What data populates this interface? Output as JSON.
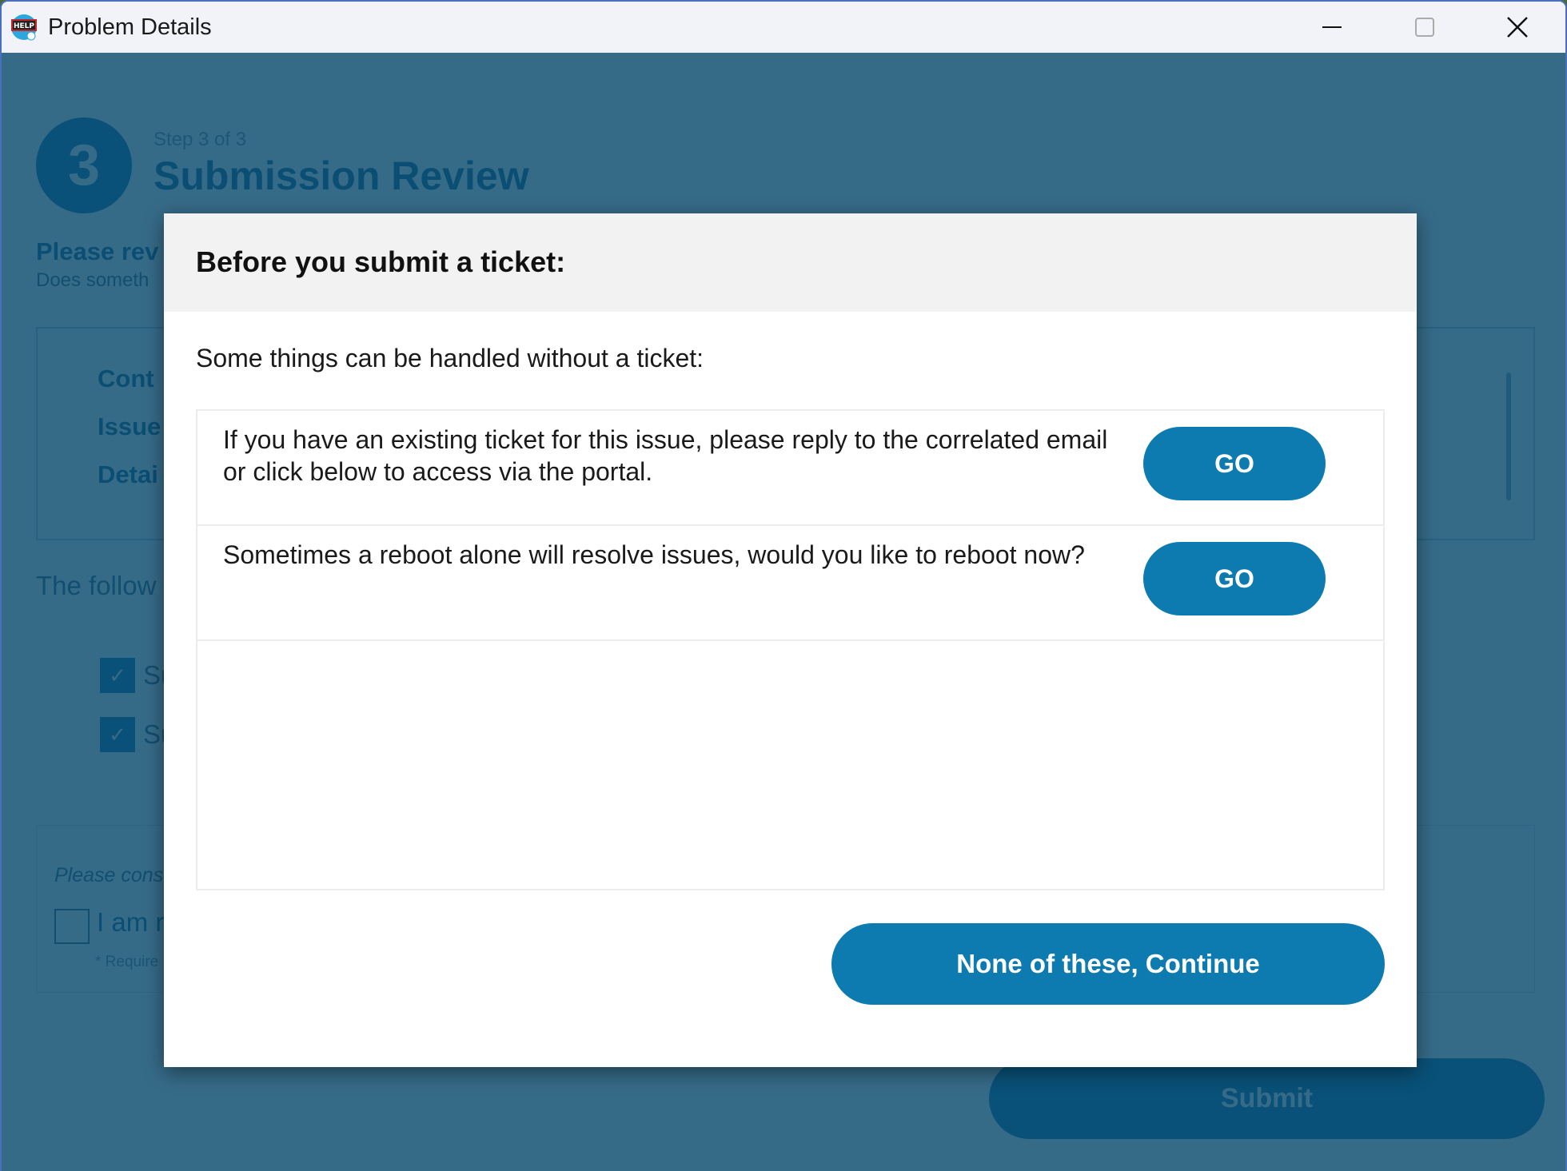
{
  "window": {
    "title": "Problem Details",
    "app_icon": "help-globe-icon",
    "controls": {
      "minimize": "minimize-icon",
      "maximize": "maximize-icon",
      "close": "close-icon"
    }
  },
  "background": {
    "step_number": "3",
    "step_label": "Step 3 of 3",
    "page_title": "Submission Review",
    "review_heading": "Please rev",
    "review_sub": "Does someth",
    "summary_labels": [
      "Cont",
      "Issue",
      "Detai"
    ],
    "following_text": "The follow",
    "checked_items": [
      "Su",
      "Su"
    ],
    "consent_prompt": "Please cons",
    "consent_text": "I am r",
    "required_note": "* Require",
    "submit_label": "Submit"
  },
  "modal": {
    "title": "Before you submit a ticket:",
    "intro": "Some things can be handled without a ticket:",
    "options": [
      {
        "text": "If you have an existing ticket for this issue, please reply to the correlated email or click below to access via the portal.",
        "button": "GO"
      },
      {
        "text": "Sometimes a reboot alone will resolve issues, would you like to reboot now?",
        "button": "GO"
      }
    ],
    "continue_label": "None of these, Continue"
  },
  "colors": {
    "primary": "#0d7bb0",
    "overlay": "#35718e",
    "header_bg": "#f2f2f2"
  }
}
